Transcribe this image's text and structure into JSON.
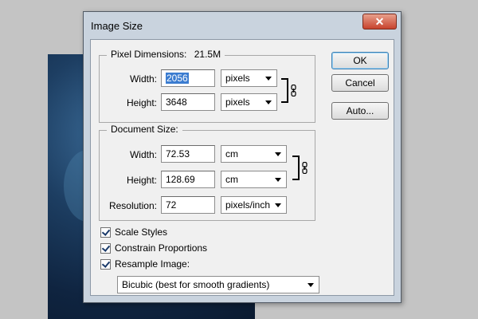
{
  "window": {
    "title": "Image Size",
    "close_glyph": "✕"
  },
  "pixel_dimensions": {
    "legend": "Pixel Dimensions:",
    "size": "21.5M",
    "width_label": "Width:",
    "width_value": "2056",
    "width_unit": "pixels",
    "height_label": "Height:",
    "height_value": "3648",
    "height_unit": "pixels"
  },
  "document_size": {
    "legend": "Document Size:",
    "width_label": "Width:",
    "width_value": "72.53",
    "width_unit": "cm",
    "height_label": "Height:",
    "height_value": "128.69",
    "height_unit": "cm",
    "resolution_label": "Resolution:",
    "resolution_value": "72",
    "resolution_unit": "pixels/inch"
  },
  "buttons": {
    "ok": "OK",
    "cancel": "Cancel",
    "auto": "Auto..."
  },
  "options": {
    "scale_styles": {
      "label": "Scale Styles",
      "checked": true
    },
    "constrain_proportions": {
      "label": "Constrain Proportions",
      "checked": true
    },
    "resample_image": {
      "label": "Resample Image:",
      "checked": true
    },
    "resample_method": "Bicubic (best for smooth gradients)"
  },
  "icons": {
    "link": "chain-link-icon",
    "dropdown": "chevron-down-icon",
    "close": "close-icon",
    "checkmark": "checkmark-icon"
  },
  "colors": {
    "selection": "#3b7cd0",
    "close_button": "#c7432d",
    "window_frame": "#c9d3de"
  }
}
